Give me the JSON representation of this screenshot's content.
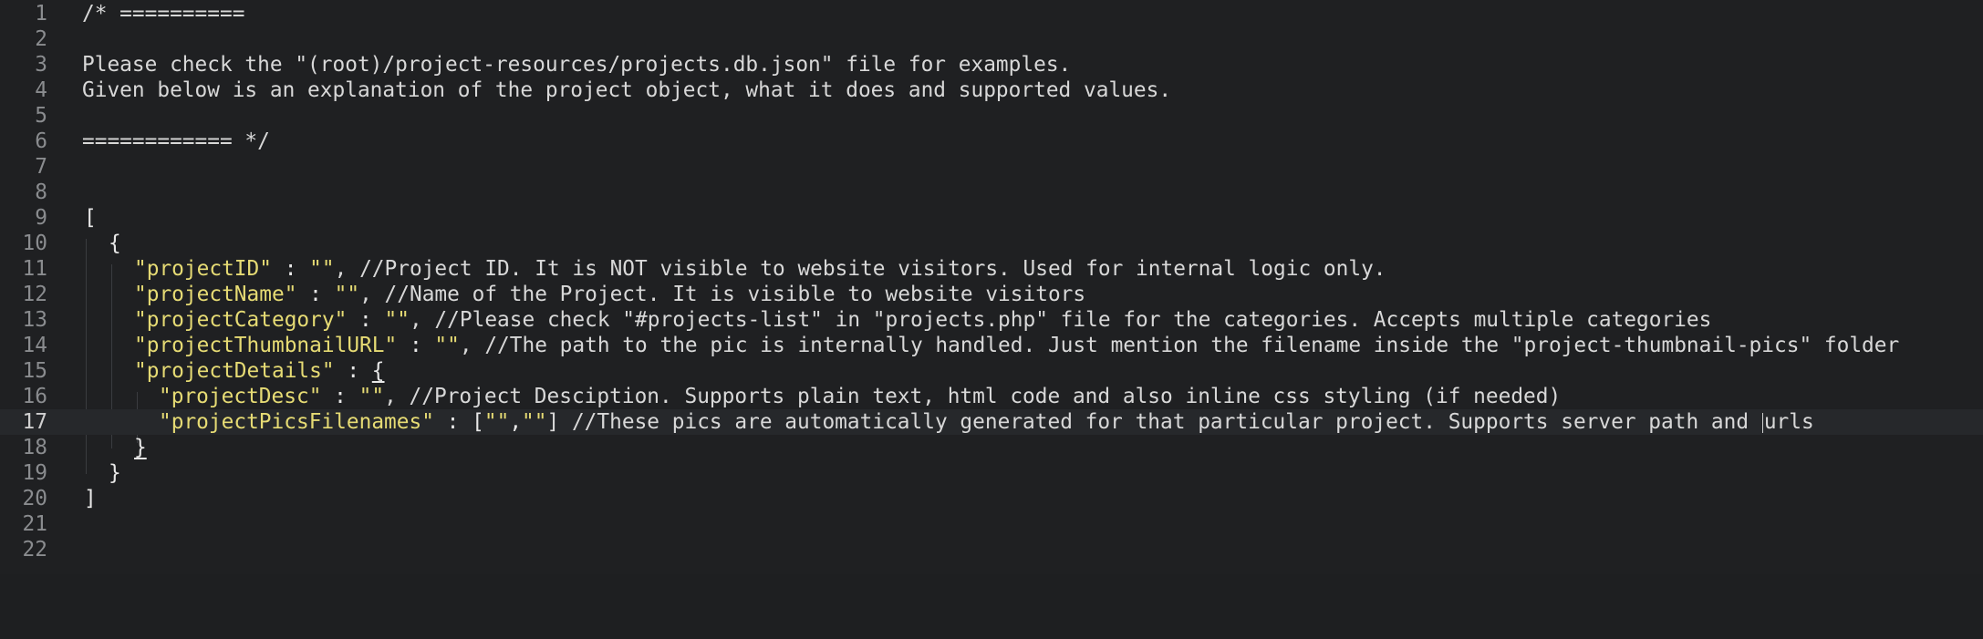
{
  "editor": {
    "line_numbers": [
      "1",
      "2",
      "3",
      "4",
      "5",
      "6",
      "7",
      "8",
      "9",
      "10",
      "11",
      "12",
      "13",
      "14",
      "15",
      "16",
      "17",
      "18",
      "19",
      "20",
      "21",
      "22"
    ],
    "active_line": "17",
    "lines": {
      "l1": "/* ==========",
      "l2": "",
      "l3": "Please check the \"(root)/project-resources/projects.db.json\" file for examples.",
      "l4": "Given below is an explanation of the project object, what it does and supported values.",
      "l5": "",
      "l6": "============ */",
      "l7": "",
      "l8": "",
      "l9": "[",
      "l10": "{",
      "l11_key": "\"projectID\"",
      "l11_rest": " : ",
      "l11_val": "\"\"",
      "l11_comment": ", //Project ID. It is NOT visible to website visitors. Used for internal logic only.",
      "l12_key": "\"projectName\"",
      "l12_rest": " : ",
      "l12_val": "\"\"",
      "l12_comment": ", //Name of the Project. It is visible to website visitors",
      "l13_key": "\"projectCategory\"",
      "l13_rest": " : ",
      "l13_val": "\"\"",
      "l13_comment": ", //Please check \"#projects-list\" in \"projects.php\" file for the categories. Accepts multiple categories",
      "l14_key": "\"projectThumbnailURL\"",
      "l14_rest": " : ",
      "l14_val": "\"\"",
      "l14_comment": ", //The path to the pic is internally handled. Just mention the filename inside the \"project-thumbnail-pics\" folder",
      "l15_key": "\"projectDetails\"",
      "l15_rest": " : ",
      "l15_brace": "{",
      "l16_key": "\"projectDesc\"",
      "l16_rest": " : ",
      "l16_val": "\"\"",
      "l16_comment": ", //Project Desciption. Supports plain text, html code and also inline css styling (if needed)",
      "l17_key": "\"projectPicsFilenames\"",
      "l17_rest": " : [",
      "l17_val1": "\"\"",
      "l17_sep": ",",
      "l17_val2": "\"\"",
      "l17_comment_a": "] //These pics are automatically generated for that particular project. Supports server path and ",
      "l17_comment_b": "urls",
      "l18": "}",
      "l19": "}",
      "l20": "]",
      "l21": "",
      "l22": ""
    }
  }
}
